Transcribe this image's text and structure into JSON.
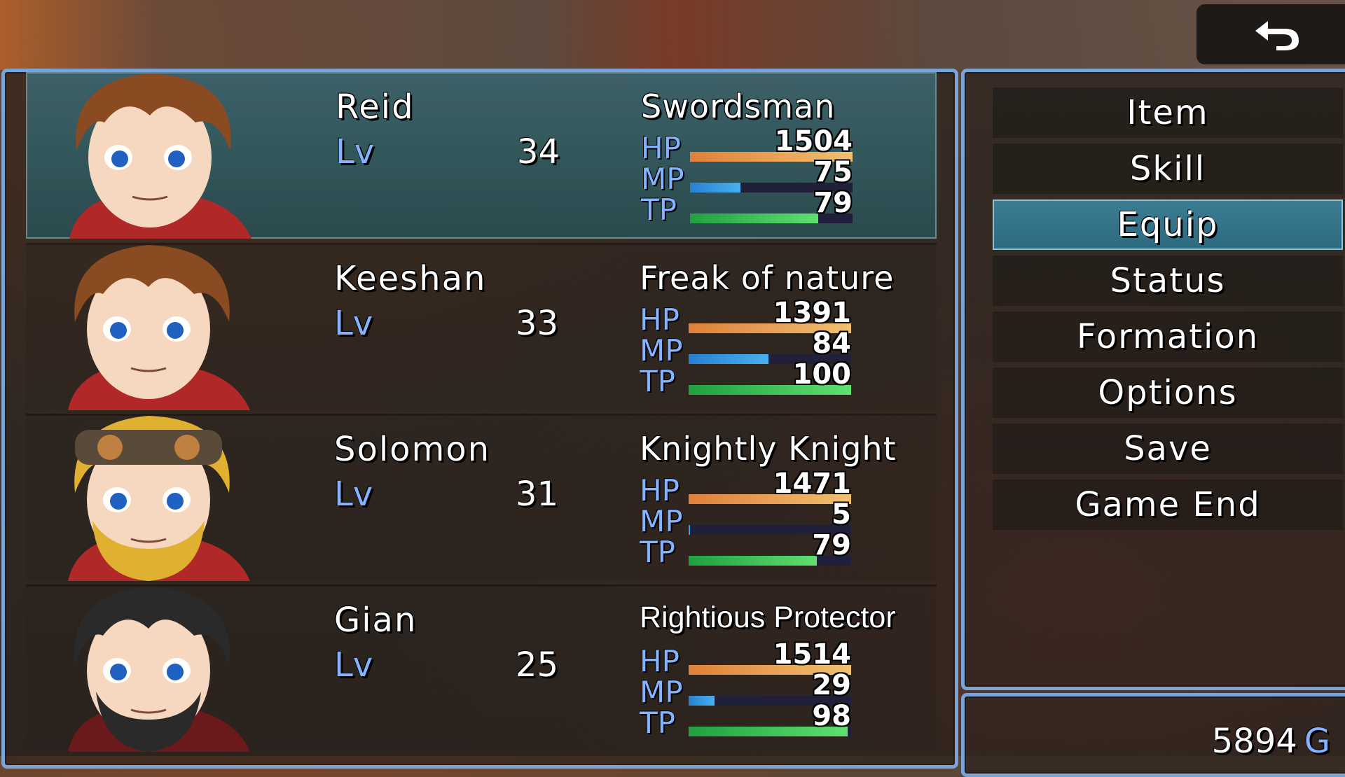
{
  "party": [
    {
      "name": "Reid",
      "lv_label": "Lv",
      "level": "34",
      "class": "Swordsman",
      "hp": {
        "label": "HP",
        "value": "1504",
        "fill": 1.0
      },
      "mp": {
        "label": "MP",
        "value": "75",
        "fill": 0.31
      },
      "tp": {
        "label": "TP",
        "value": "79",
        "fill": 0.79
      },
      "hair": "#8a4a22",
      "selected": true
    },
    {
      "name": "Keeshan",
      "lv_label": "Lv",
      "level": "33",
      "class": "Freak of nature",
      "hp": {
        "label": "HP",
        "value": "1391",
        "fill": 1.0
      },
      "mp": {
        "label": "MP",
        "value": "84",
        "fill": 0.49
      },
      "tp": {
        "label": "TP",
        "value": "100",
        "fill": 1.0
      },
      "hair": "#8a4a22",
      "selected": false
    },
    {
      "name": "Solomon",
      "lv_label": "Lv",
      "level": "31",
      "class": "Knightly Knight",
      "hp": {
        "label": "HP",
        "value": "1471",
        "fill": 1.0
      },
      "mp": {
        "label": "MP",
        "value": "5",
        "fill": 0.01
      },
      "tp": {
        "label": "TP",
        "value": "79",
        "fill": 0.79
      },
      "hair": "#e0b030",
      "selected": false
    },
    {
      "name": "Gian",
      "lv_label": "Lv",
      "level": "25",
      "class": "Rightious Protector",
      "hp": {
        "label": "HP",
        "value": "1514",
        "fill": 1.0
      },
      "mp": {
        "label": "MP",
        "value": "29",
        "fill": 0.16
      },
      "tp": {
        "label": "TP",
        "value": "98",
        "fill": 0.98
      },
      "hair": "#2a2a2a",
      "selected": false
    }
  ],
  "menu": {
    "items": [
      "Item",
      "Skill",
      "Equip",
      "Status",
      "Formation",
      "Options",
      "Save",
      "Game End"
    ],
    "selected_index": 2
  },
  "gold": {
    "amount": "5894",
    "unit": "G"
  },
  "colors": {
    "window_border": "#7aa4d8",
    "system_blue": "#84b4ff",
    "selected": "#3c7d94"
  }
}
